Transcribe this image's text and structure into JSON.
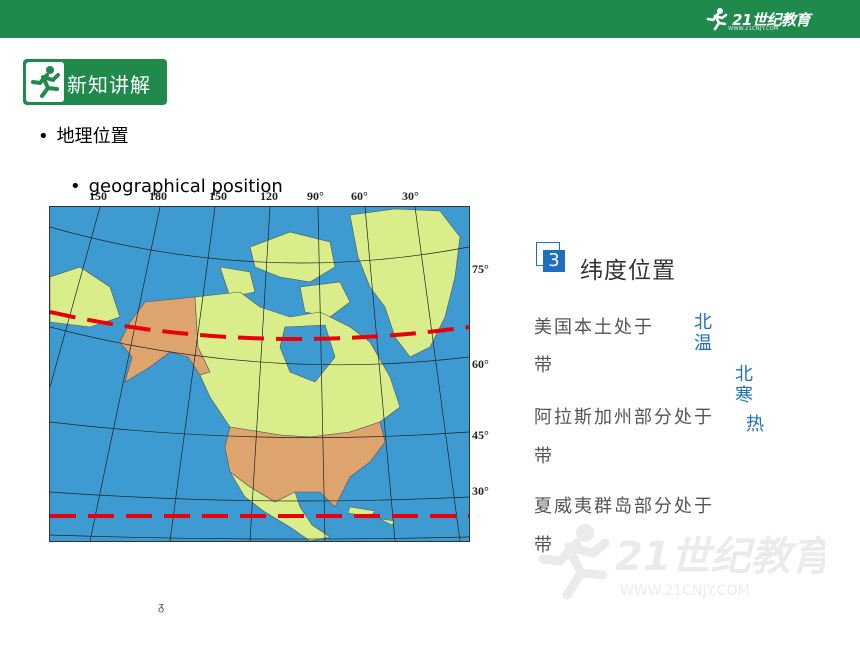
{
  "header": {
    "logo_text": "21世纪教育",
    "logo_sub": "WWW.21CNJY.COM",
    "accent_color": "#1f8a4c"
  },
  "badge": {
    "title": "新知讲解",
    "icon": "runner-icon"
  },
  "bullets": [
    {
      "text": "地理位置"
    },
    {
      "text": "geographical position"
    }
  ],
  "map": {
    "top_labels": [
      "150",
      "180",
      "150",
      "120",
      "90°",
      "60°",
      "30°"
    ],
    "side_labels": [
      "75°",
      "60°",
      "45°",
      "30°"
    ],
    "land_color": "#d9ee8a",
    "usa_color": "#dea46e",
    "ocean_color": "#3d9bd2",
    "line_color": "#e8000b"
  },
  "section": {
    "number": "3",
    "title": "纬度位置"
  },
  "questions": [
    {
      "prefix": "美国本土处于",
      "suffix": "带"
    },
    {
      "prefix": "阿拉斯加州部分处于",
      "suffix": "带"
    },
    {
      "prefix": "夏威夷群岛部分处于",
      "suffix": "带"
    }
  ],
  "answers": {
    "a1_line1": "北",
    "a1_line2": "温",
    "a2_line1": "北",
    "a2_line2": "寒",
    "a3": "热"
  },
  "watermark": {
    "text": "21世纪教育",
    "sub": "WWW.21CNJY.COM"
  },
  "misc_mark": "ᵹ"
}
